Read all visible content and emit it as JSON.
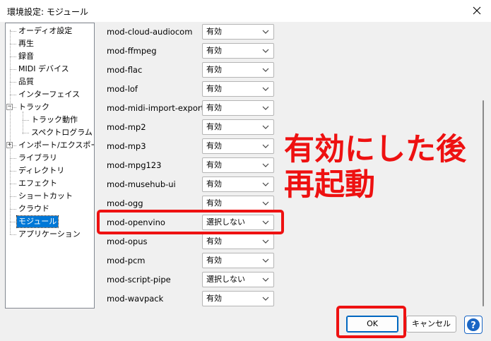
{
  "window": {
    "title": "環境設定: モジュール"
  },
  "tree": [
    {
      "label": "オーディオ設定",
      "level": 0
    },
    {
      "label": "再生",
      "level": 0
    },
    {
      "label": "録音",
      "level": 0
    },
    {
      "label": "MIDI デバイス",
      "level": 0
    },
    {
      "label": "品質",
      "level": 0
    },
    {
      "label": "インターフェイス",
      "level": 0
    },
    {
      "label": "トラック",
      "level": 0,
      "expander": "−"
    },
    {
      "label": "トラック動作",
      "level": 1
    },
    {
      "label": "スペクトログラム",
      "level": 1
    },
    {
      "label": "インポート/エクスポート",
      "level": 0,
      "expander": "+"
    },
    {
      "label": "ライブラリ",
      "level": 0
    },
    {
      "label": "ディレクトリ",
      "level": 0
    },
    {
      "label": "エフェクト",
      "level": 0
    },
    {
      "label": "ショートカット",
      "level": 0
    },
    {
      "label": "クラウド",
      "level": 0
    },
    {
      "label": "モジュール",
      "level": 0,
      "selected": true
    },
    {
      "label": "アプリケーション",
      "level": 0
    }
  ],
  "modules": [
    {
      "name": "mod-cloud-audiocom",
      "value": "有効"
    },
    {
      "name": "mod-ffmpeg",
      "value": "有効"
    },
    {
      "name": "mod-flac",
      "value": "有効"
    },
    {
      "name": "mod-lof",
      "value": "有効"
    },
    {
      "name": "mod-midi-import-export",
      "value": "有効"
    },
    {
      "name": "mod-mp2",
      "value": "有効"
    },
    {
      "name": "mod-mp3",
      "value": "有効"
    },
    {
      "name": "mod-mpg123",
      "value": "有効"
    },
    {
      "name": "mod-musehub-ui",
      "value": "有効"
    },
    {
      "name": "mod-ogg",
      "value": "有効"
    },
    {
      "name": "mod-openvino",
      "value": "選択しない"
    },
    {
      "name": "mod-opus",
      "value": "有効"
    },
    {
      "name": "mod-pcm",
      "value": "有効"
    },
    {
      "name": "mod-script-pipe",
      "value": "選択しない"
    },
    {
      "name": "mod-wavpack",
      "value": "有効"
    }
  ],
  "annotation": {
    "line1": "有効にした後",
    "line2": "再起動"
  },
  "buttons": {
    "ok": "OK",
    "cancel": "キャンセル"
  },
  "icons": {
    "close": "close-icon",
    "help": "help-icon",
    "chevron": "chevron-down-icon"
  },
  "colors": {
    "annotation": "#ee1111",
    "selection": "#0078d7"
  }
}
